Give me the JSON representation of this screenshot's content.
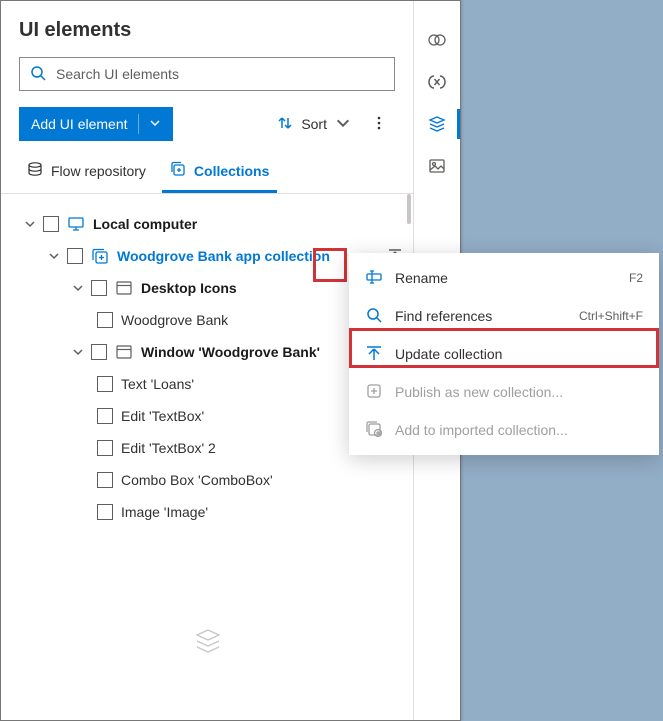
{
  "panel": {
    "title": "UI elements",
    "search_placeholder": "Search UI elements",
    "add_button": "Add UI element",
    "sort_label": "Sort"
  },
  "tabs": {
    "repo": "Flow repository",
    "collections": "Collections"
  },
  "tree": {
    "root": "Local computer",
    "collection": "Woodgrove Bank app collection",
    "group1": "Desktop Icons",
    "group1_item1": "Woodgrove Bank",
    "group2": "Window 'Woodgrove Bank'",
    "group2_item1": "Text 'Loans'",
    "group2_item2": "Edit 'TextBox'",
    "group2_item3": "Edit 'TextBox' 2",
    "group2_item4": "Combo Box 'ComboBox'",
    "group2_item5": "Image 'Image'"
  },
  "rail": {
    "a": "aux",
    "b": "vars",
    "c": "layers",
    "d": "images"
  },
  "menu": {
    "rename": "Rename",
    "rename_key": "F2",
    "find": "Find references",
    "find_key": "Ctrl+Shift+F",
    "update": "Update collection",
    "publish": "Publish as new collection...",
    "addto": "Add to imported collection..."
  }
}
